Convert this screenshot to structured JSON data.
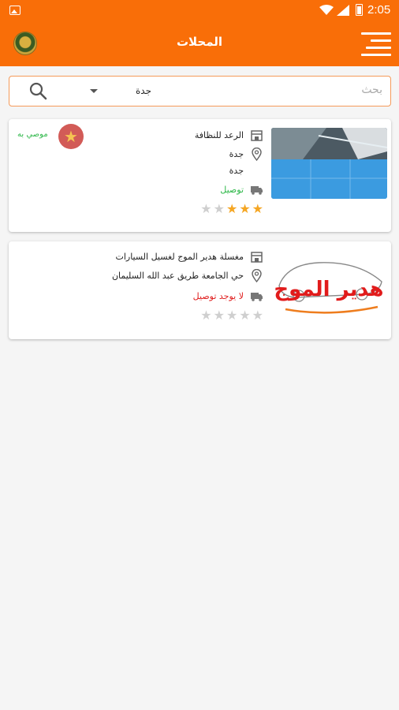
{
  "status_bar": {
    "time": "2:05"
  },
  "app_bar": {
    "title": "المحلات"
  },
  "search": {
    "placeholder": "بحث",
    "city": "جدة"
  },
  "shops": [
    {
      "name": "الرعد للنظافة",
      "address_line1": "جدة",
      "address_line2": "جدة",
      "delivery": "توصيل",
      "rating": 3,
      "rating_max": 5,
      "featured": true,
      "featured_label": "موصي به"
    },
    {
      "name": "مغسلة هدير الموج لغسيل السيارات",
      "address_line1": "حي الجامعة طريق عبد الله السليمان",
      "delivery": "لا يوجد توصيل",
      "rating": 0,
      "rating_max": 5,
      "featured": false,
      "logo_text": "هدير الموج"
    }
  ],
  "colors": {
    "primary": "#f96e08",
    "delivery_yes": "#2fb84a",
    "delivery_no": "#e02020",
    "star": "#f5a623"
  }
}
